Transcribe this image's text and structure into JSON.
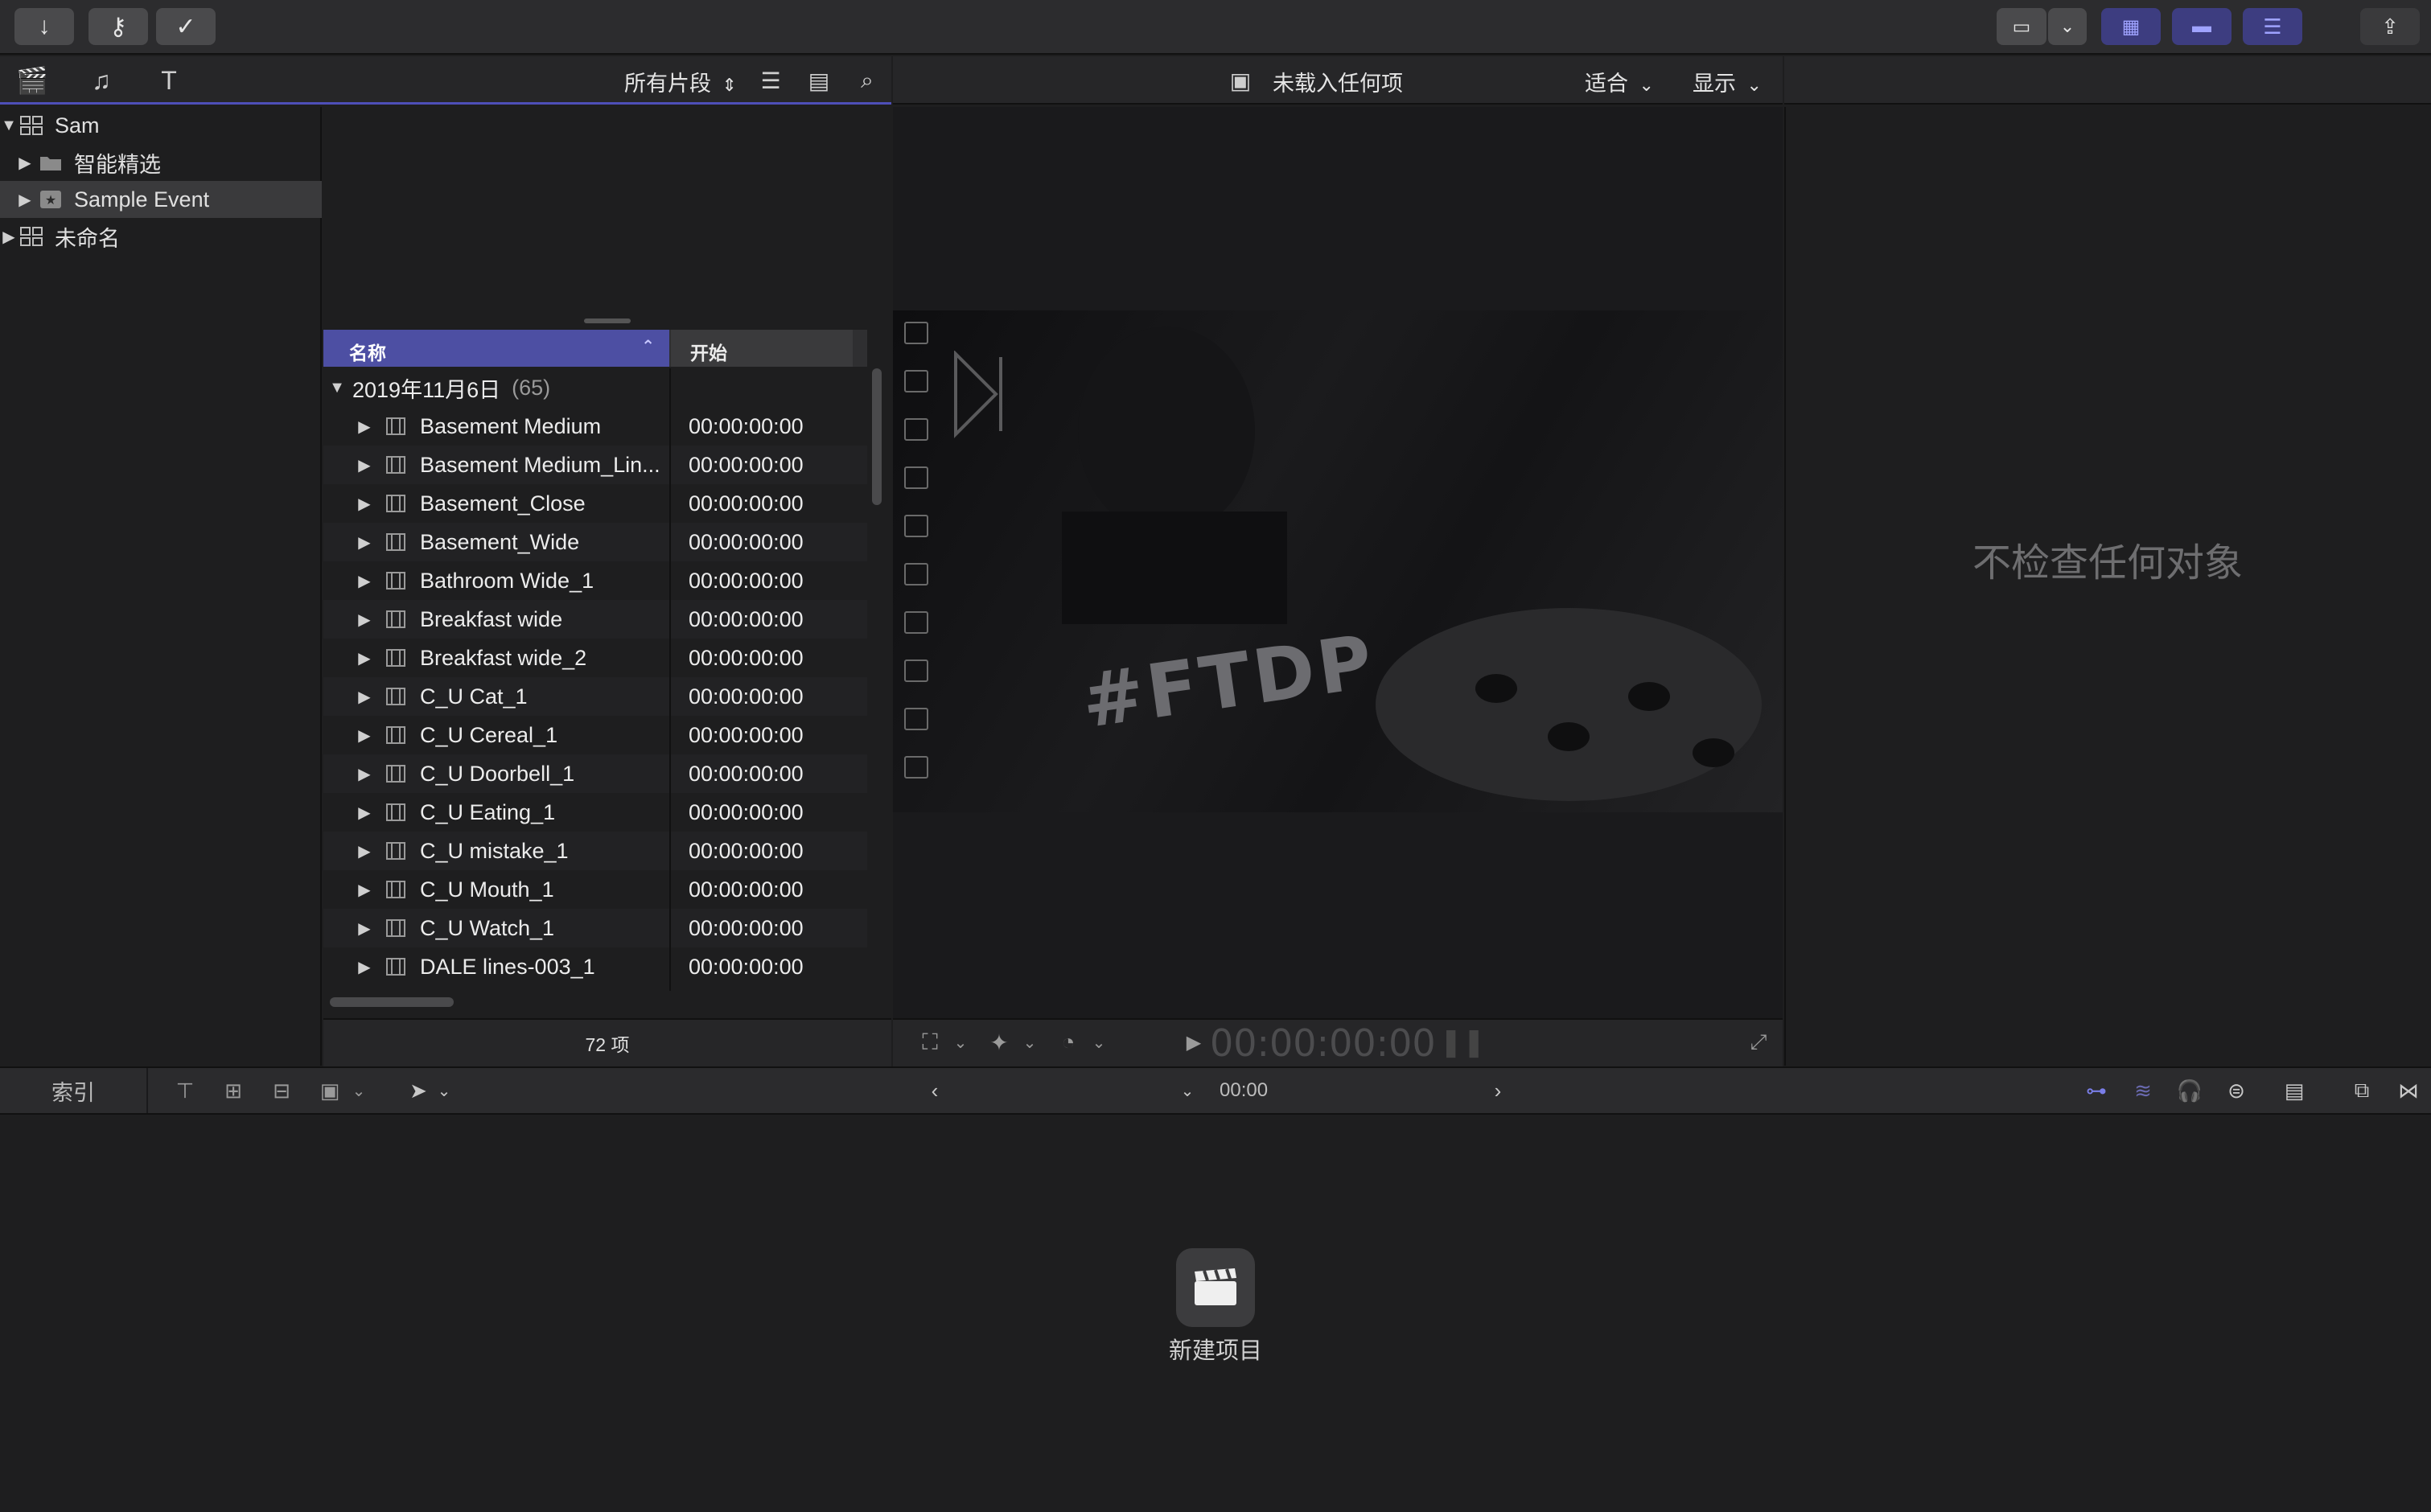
{
  "toolbar": {
    "left_buttons": [
      "import-icon",
      "keyword-icon",
      "checkmark-icon"
    ],
    "right_buttons": [
      "display-icon",
      "chevron-down-icon",
      "browser-toggle-icon",
      "timeline-toggle-icon",
      "inspector-toggle-icon",
      "share-icon"
    ]
  },
  "library_header": {
    "filter_label": "所有片段"
  },
  "libraries": [
    {
      "name": "Sam",
      "expanded": true
    },
    {
      "name": "智能精选",
      "type": "folder"
    },
    {
      "name": "Sample Event",
      "type": "event",
      "selected": true
    },
    {
      "name": "未命名",
      "expanded": false
    }
  ],
  "browser": {
    "columns": {
      "name": "名称",
      "start": "开始"
    },
    "group": {
      "date": "2019年11月6日",
      "count": "(65)"
    },
    "clips": [
      {
        "name": "Basement Medium",
        "start": "00:00:00:00"
      },
      {
        "name": "Basement Medium_Lin...",
        "start": "00:00:00:00"
      },
      {
        "name": "Basement_Close",
        "start": "00:00:00:00"
      },
      {
        "name": "Basement_Wide",
        "start": "00:00:00:00"
      },
      {
        "name": "Bathroom Wide_1",
        "start": "00:00:00:00"
      },
      {
        "name": "Breakfast wide",
        "start": "00:00:00:00"
      },
      {
        "name": "Breakfast wide_2",
        "start": "00:00:00:00"
      },
      {
        "name": "C_U Cat_1",
        "start": "00:00:00:00"
      },
      {
        "name": "C_U Cereal_1",
        "start": "00:00:00:00"
      },
      {
        "name": "C_U Doorbell_1",
        "start": "00:00:00:00"
      },
      {
        "name": "C_U Eating_1",
        "start": "00:00:00:00"
      },
      {
        "name": "C_U mistake_1",
        "start": "00:00:00:00"
      },
      {
        "name": "C_U Mouth_1",
        "start": "00:00:00:00"
      },
      {
        "name": "C_U Watch_1",
        "start": "00:00:00:00"
      },
      {
        "name": "DALE lines-003_1",
        "start": "00:00:00:00"
      }
    ],
    "item_count": "72 项"
  },
  "viewer": {
    "title": "未载入任何项",
    "fit_label": "适合",
    "display_label": "显示",
    "timecode": "00:00:00:00",
    "shirt_text": "#FTDP"
  },
  "inspector": {
    "empty_text": "不检查任何对象"
  },
  "timeline_bar": {
    "index_label": "索引",
    "time": "00:00"
  },
  "timeline": {
    "new_project_label": "新建项目"
  },
  "colors": {
    "accent": "#4d4fa3",
    "accent_light": "#7a7ee8",
    "background": "#1e1e1f"
  }
}
